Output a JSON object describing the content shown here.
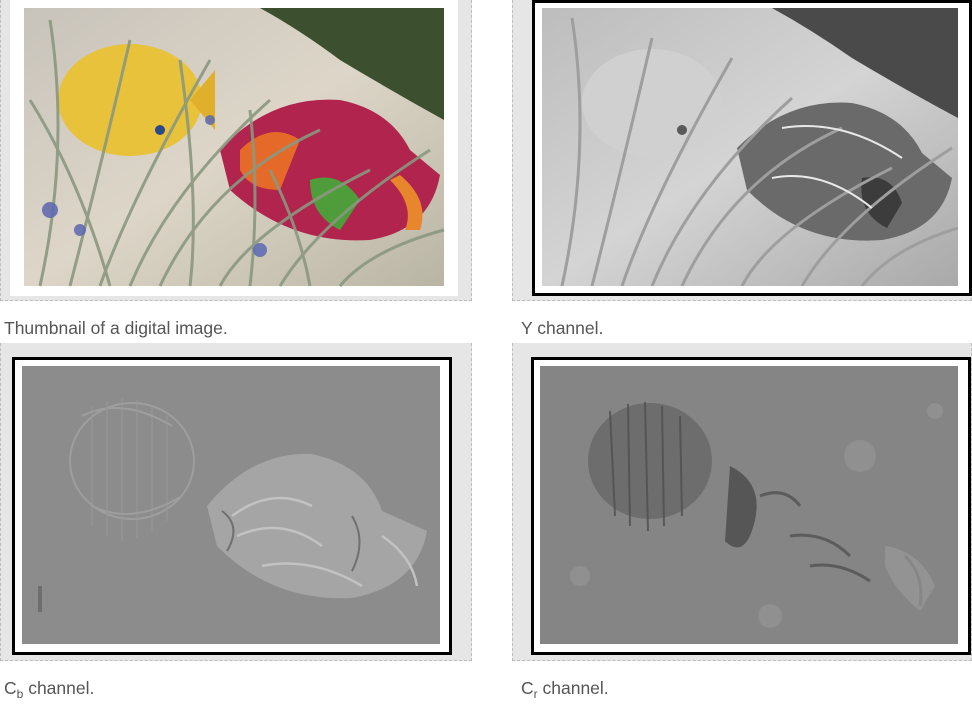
{
  "figures": [
    {
      "id": "original",
      "caption": "Thumbnail of a digital image.",
      "image_alt": "Colorful wooden fish among grass blades"
    },
    {
      "id": "y",
      "caption_main": "Y",
      "caption_rest": " channel.",
      "image_alt": "Grayscale luminance image of the fish"
    },
    {
      "id": "cb",
      "caption_main": "C",
      "caption_sub": "b",
      "caption_rest": " channel.",
      "image_alt": "Blue-difference chroma channel"
    },
    {
      "id": "cr",
      "caption_main": "C",
      "caption_sub": "r",
      "caption_rest": " channel.",
      "image_alt": "Red-difference chroma channel"
    }
  ],
  "colors": {
    "panel_bg": "#e6e6e6",
    "caption_text": "#555555",
    "frame_border": "#000000",
    "chroma_gray": "#808080"
  }
}
